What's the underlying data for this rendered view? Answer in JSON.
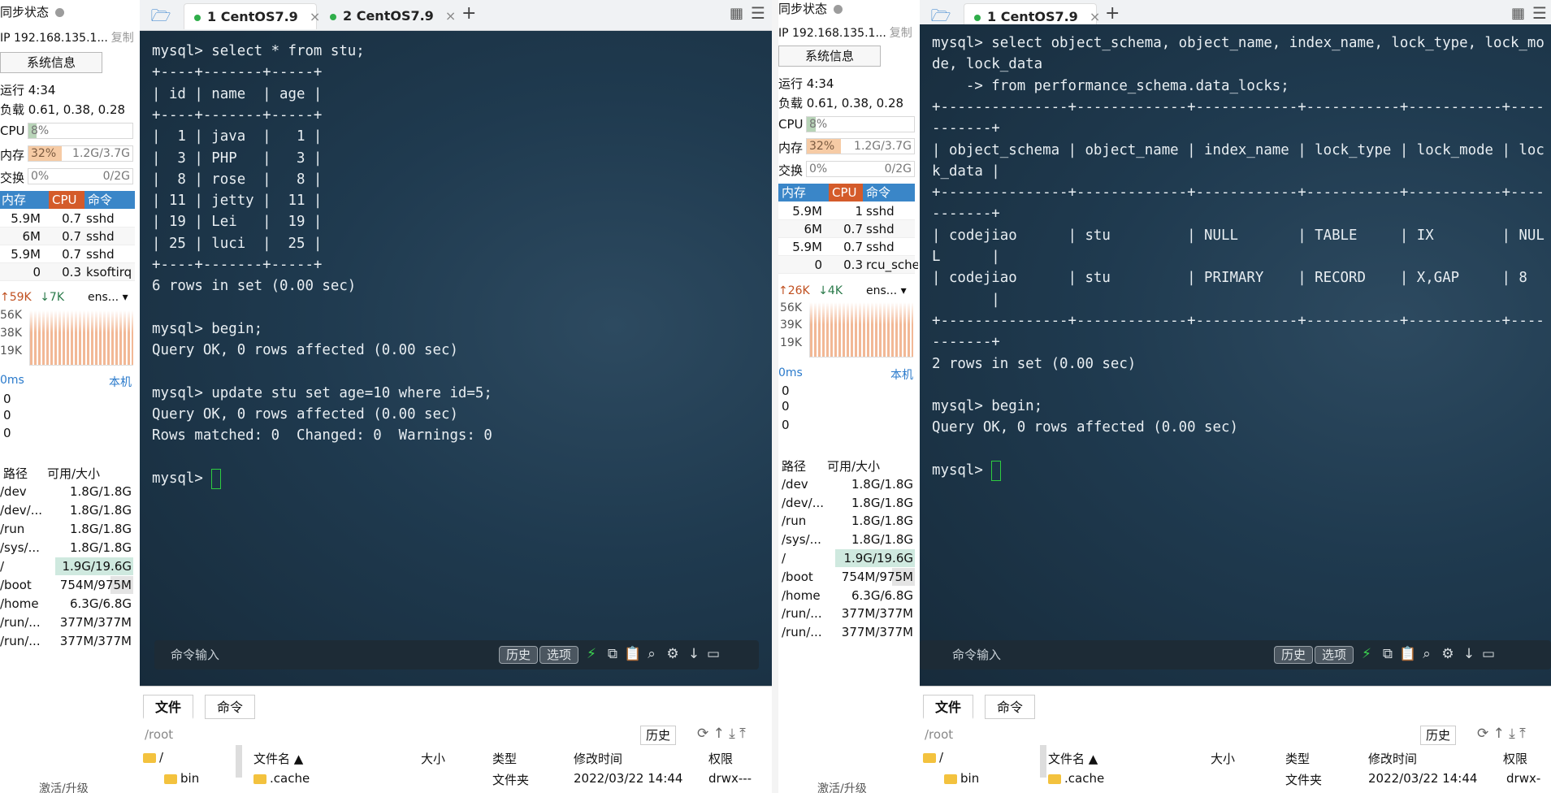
{
  "left_sidebar": {
    "sync_label": "同步状态",
    "ip": "IP 192.168.135.1...",
    "copy": "复制",
    "sysinfo": "系统信息",
    "uptime": "运行 4:34",
    "load": "负载 0.61, 0.38, 0.28",
    "cpu_label": "CPU",
    "cpu_pct": "8%",
    "cpu_fill": 0.08,
    "mem_label": "内存",
    "mem_pct": "32%",
    "mem_amt": "1.2G/3.7G",
    "mem_fill": 0.32,
    "swap_label": "交换",
    "swap_pct": "0%",
    "swap_amt": "0/2G",
    "swap_fill": 0,
    "proc_head": [
      "内存",
      "CPU",
      "命令"
    ],
    "procs": [
      {
        "mem": "5.9M",
        "cpu": "0.7",
        "cmd": "sshd"
      },
      {
        "mem": "6M",
        "cpu": "0.7",
        "cmd": "sshd"
      },
      {
        "mem": "5.9M",
        "cpu": "0.7",
        "cmd": "sshd"
      },
      {
        "mem": "0",
        "cpu": "0.3",
        "cmd": "ksoftirq"
      }
    ],
    "net_up": "↑59K",
    "net_down": "↓7K",
    "net_if": "ens...",
    "net_scale": [
      "56K",
      "38K",
      "19K"
    ],
    "ping": "0ms",
    "ping_host": "本机",
    "ping_vals": [
      "0",
      "0",
      "0"
    ],
    "disk_head": [
      "路径",
      "可用/大小"
    ],
    "disks": [
      {
        "path": "/dev",
        "size": "1.8G/1.8G"
      },
      {
        "path": "/dev/...",
        "size": "1.8G/1.8G"
      },
      {
        "path": "/run",
        "size": "1.8G/1.8G"
      },
      {
        "path": "/sys/...",
        "size": "1.8G/1.8G"
      },
      {
        "path": "/",
        "size": "1.9G/19.6G"
      },
      {
        "path": "/boot",
        "size": "754M/975M"
      },
      {
        "path": "/home",
        "size": "6.3G/6.8G"
      },
      {
        "path": "/run/...",
        "size": "377M/377M"
      },
      {
        "path": "/run/...",
        "size": "377M/377M"
      }
    ],
    "activate": "激活/升级"
  },
  "right_sidebar": {
    "sync_label": "同步状态",
    "ip": "IP 192.168.135.1...",
    "copy": "复制",
    "sysinfo": "系统信息",
    "uptime": "运行 4:34",
    "load": "负载 0.61, 0.38, 0.28",
    "cpu_label": "CPU",
    "cpu_pct": "8%",
    "cpu_fill": 0.08,
    "mem_label": "内存",
    "mem_pct": "32%",
    "mem_amt": "1.2G/3.7G",
    "mem_fill": 0.32,
    "swap_label": "交换",
    "swap_pct": "0%",
    "swap_amt": "0/2G",
    "swap_fill": 0,
    "proc_head": [
      "内存",
      "CPU",
      "命令"
    ],
    "procs": [
      {
        "mem": "5.9M",
        "cpu": "1",
        "cmd": "sshd"
      },
      {
        "mem": "6M",
        "cpu": "0.7",
        "cmd": "sshd"
      },
      {
        "mem": "5.9M",
        "cpu": "0.7",
        "cmd": "sshd"
      },
      {
        "mem": "0",
        "cpu": "0.3",
        "cmd": "rcu_sche"
      }
    ],
    "net_up": "↑26K",
    "net_down": "↓4K",
    "net_if": "ens...",
    "net_scale": [
      "56K",
      "39K",
      "19K"
    ],
    "ping": "0ms",
    "ping_host": "本机",
    "ping_vals": [
      "0",
      "0",
      "0"
    ],
    "disk_head": [
      "路径",
      "可用/大小"
    ],
    "disks": [
      {
        "path": "/dev",
        "size": "1.8G/1.8G"
      },
      {
        "path": "/dev/...",
        "size": "1.8G/1.8G"
      },
      {
        "path": "/run",
        "size": "1.8G/1.8G"
      },
      {
        "path": "/sys/...",
        "size": "1.8G/1.8G"
      },
      {
        "path": "/",
        "size": "1.9G/19.6G"
      },
      {
        "path": "/boot",
        "size": "754M/975M"
      },
      {
        "path": "/home",
        "size": "6.3G/6.8G"
      },
      {
        "path": "/run/...",
        "size": "377M/377M"
      },
      {
        "path": "/run/...",
        "size": "377M/377M"
      }
    ],
    "activate": "激活/升级"
  },
  "left_window": {
    "tabs": [
      {
        "label": "1 CentOS7.9",
        "close": "×"
      },
      {
        "label": "2 CentOS7.9",
        "close": "×"
      }
    ],
    "add_tab": "+",
    "lines": [
      "mysql> select * from stu;",
      "+----+-------+-----+",
      "| id | name  | age |",
      "+----+-------+-----+",
      "|  1 | java  |   1 |",
      "|  3 | PHP   |   3 |",
      "|  8 | rose  |   8 |",
      "| 11 | jetty |  11 |",
      "| 19 | Lei   |  19 |",
      "| 25 | luci  |  25 |",
      "+----+-------+-----+",
      "6 rows in set (0.00 sec)",
      "",
      "mysql> begin;",
      "Query OK, 0 rows affected (0.00 sec)",
      "",
      "mysql> update stu set age=10 where id=5;",
      "Query OK, 0 rows affected (0.00 sec)",
      "Rows matched: 0  Changed: 0  Warnings: 0",
      "",
      "mysql> "
    ],
    "cmd_input": "命令输入",
    "history_btn": "历史",
    "options_btn": "选项",
    "file_tab": "文件",
    "cmd_tab": "命令",
    "path": "/root",
    "history": "历史",
    "tree_root": "/",
    "tree_bin": "bin",
    "file_cols": [
      "文件名",
      "大小",
      "类型",
      "修改时间",
      "权限"
    ],
    "files": [
      {
        "name": ".cache",
        "type": "文件夹",
        "time": "2022/03/22 14:44",
        "perm": "drwx---"
      }
    ]
  },
  "right_window": {
    "tabs": [
      {
        "label": "1 CentOS7.9",
        "close": "×"
      }
    ],
    "add_tab": "+",
    "lines": [
      "mysql> select object_schema, object_name, index_name, lock_type, lock_mo",
      "de, lock_data",
      "    -> from performance_schema.data_locks;",
      "+---------------+-------------+------------+-----------+-----------+----",
      "-------+",
      "| object_schema | object_name | index_name | lock_type | lock_mode | loc",
      "k_data |",
      "+---------------+-------------+------------+-----------+-----------+----",
      "-------+",
      "| codejiao      | stu         | NULL       | TABLE     | IX        | NUL",
      "L      |",
      "| codejiao      | stu         | PRIMARY    | RECORD    | X,GAP     | 8",
      "       |",
      "+---------------+-------------+------------+-----------+-----------+----",
      "-------+",
      "2 rows in set (0.00 sec)",
      "",
      "mysql> begin;",
      "Query OK, 0 rows affected (0.00 sec)",
      "",
      "mysql> "
    ],
    "cmd_input": "命令输入",
    "history_btn": "历史",
    "options_btn": "选项",
    "file_tab": "文件",
    "cmd_tab": "命令",
    "path": "/root",
    "history": "历史",
    "tree_root": "/",
    "tree_bin": "bin",
    "file_cols": [
      "文件名",
      "大小",
      "类型",
      "修改时间",
      "权限"
    ],
    "files": [
      {
        "name": ".cache",
        "type": "文件夹",
        "time": "2022/03/22 14:44",
        "perm": "drwx-"
      }
    ]
  }
}
